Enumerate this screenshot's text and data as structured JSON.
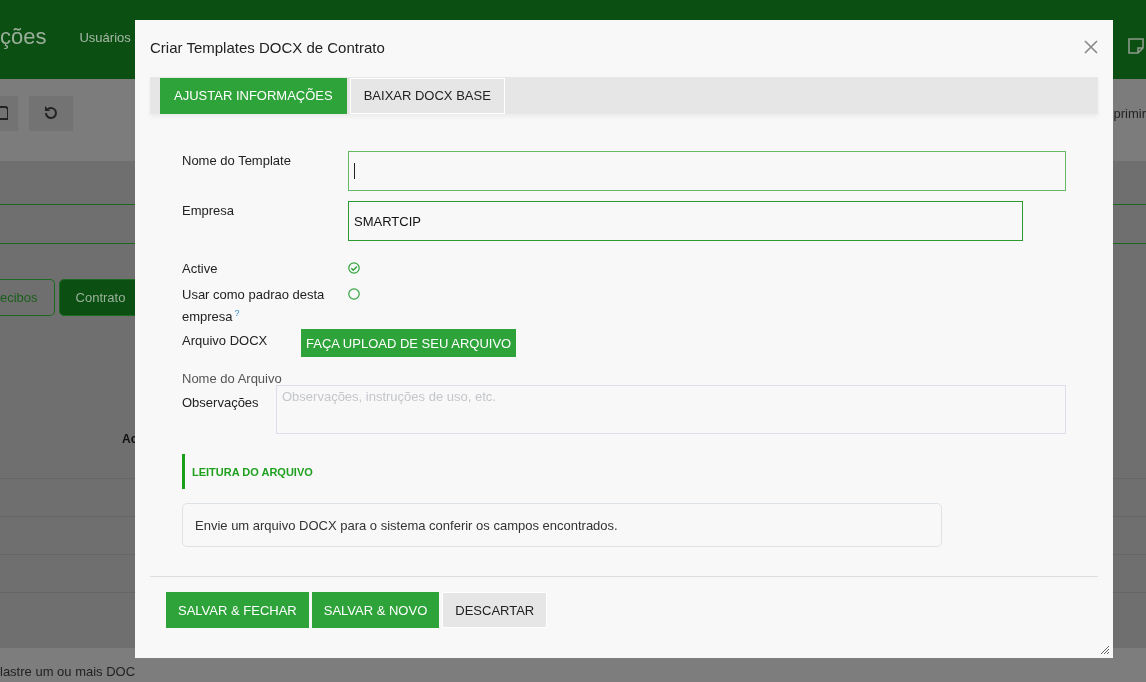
{
  "background": {
    "brand": "ções",
    "nav": [
      "Usuários"
    ],
    "toolbar_text": "primir",
    "tabs": [
      {
        "label": "ecibos",
        "selected": false
      },
      {
        "label": "Contrato",
        "selected": true
      }
    ],
    "column_text": "Ac",
    "footer_text": "lastre um ou mais DOC"
  },
  "dialog": {
    "title": "Criar Templates DOCX de Contrato",
    "tabs": [
      {
        "label": "AJUSTAR INFORMAÇÕES",
        "selected": true
      },
      {
        "label": "BAIXAR DOCX BASE",
        "selected": false
      }
    ],
    "fields": [
      {
        "kind": "text",
        "label": "Nome do Template",
        "focused": true
      },
      {
        "kind": "select",
        "label": "Empresa",
        "value": "SMARTCIP",
        "focused": false
      },
      {
        "kind": "check",
        "label": "Active",
        "checked": true
      },
      {
        "kind": "check",
        "label": "Usar como padrao desta empresa",
        "help": "?",
        "checked": false
      },
      {
        "kind": "upload",
        "label": "Arquivo DOCX",
        "button": "FAÇA UPLOAD DE SEU ARQUIVO"
      },
      {
        "kind": "note",
        "label": "Nome do Arquivo"
      },
      {
        "kind": "textarea",
        "label": "Observações",
        "placeholder": "Observações, instruções de uso, etc."
      }
    ],
    "section": {
      "title": "LEITURA DO ARQUIVO",
      "message": "Envie um arquivo DOCX para o sistema conferir os campos encontrados."
    },
    "buttons": [
      {
        "label": "SALVAR & FECHAR",
        "kind": "primary"
      },
      {
        "label": "SALVAR & NOVO",
        "kind": "primary"
      },
      {
        "label": "DESCARTAR",
        "kind": "secondary"
      }
    ]
  }
}
